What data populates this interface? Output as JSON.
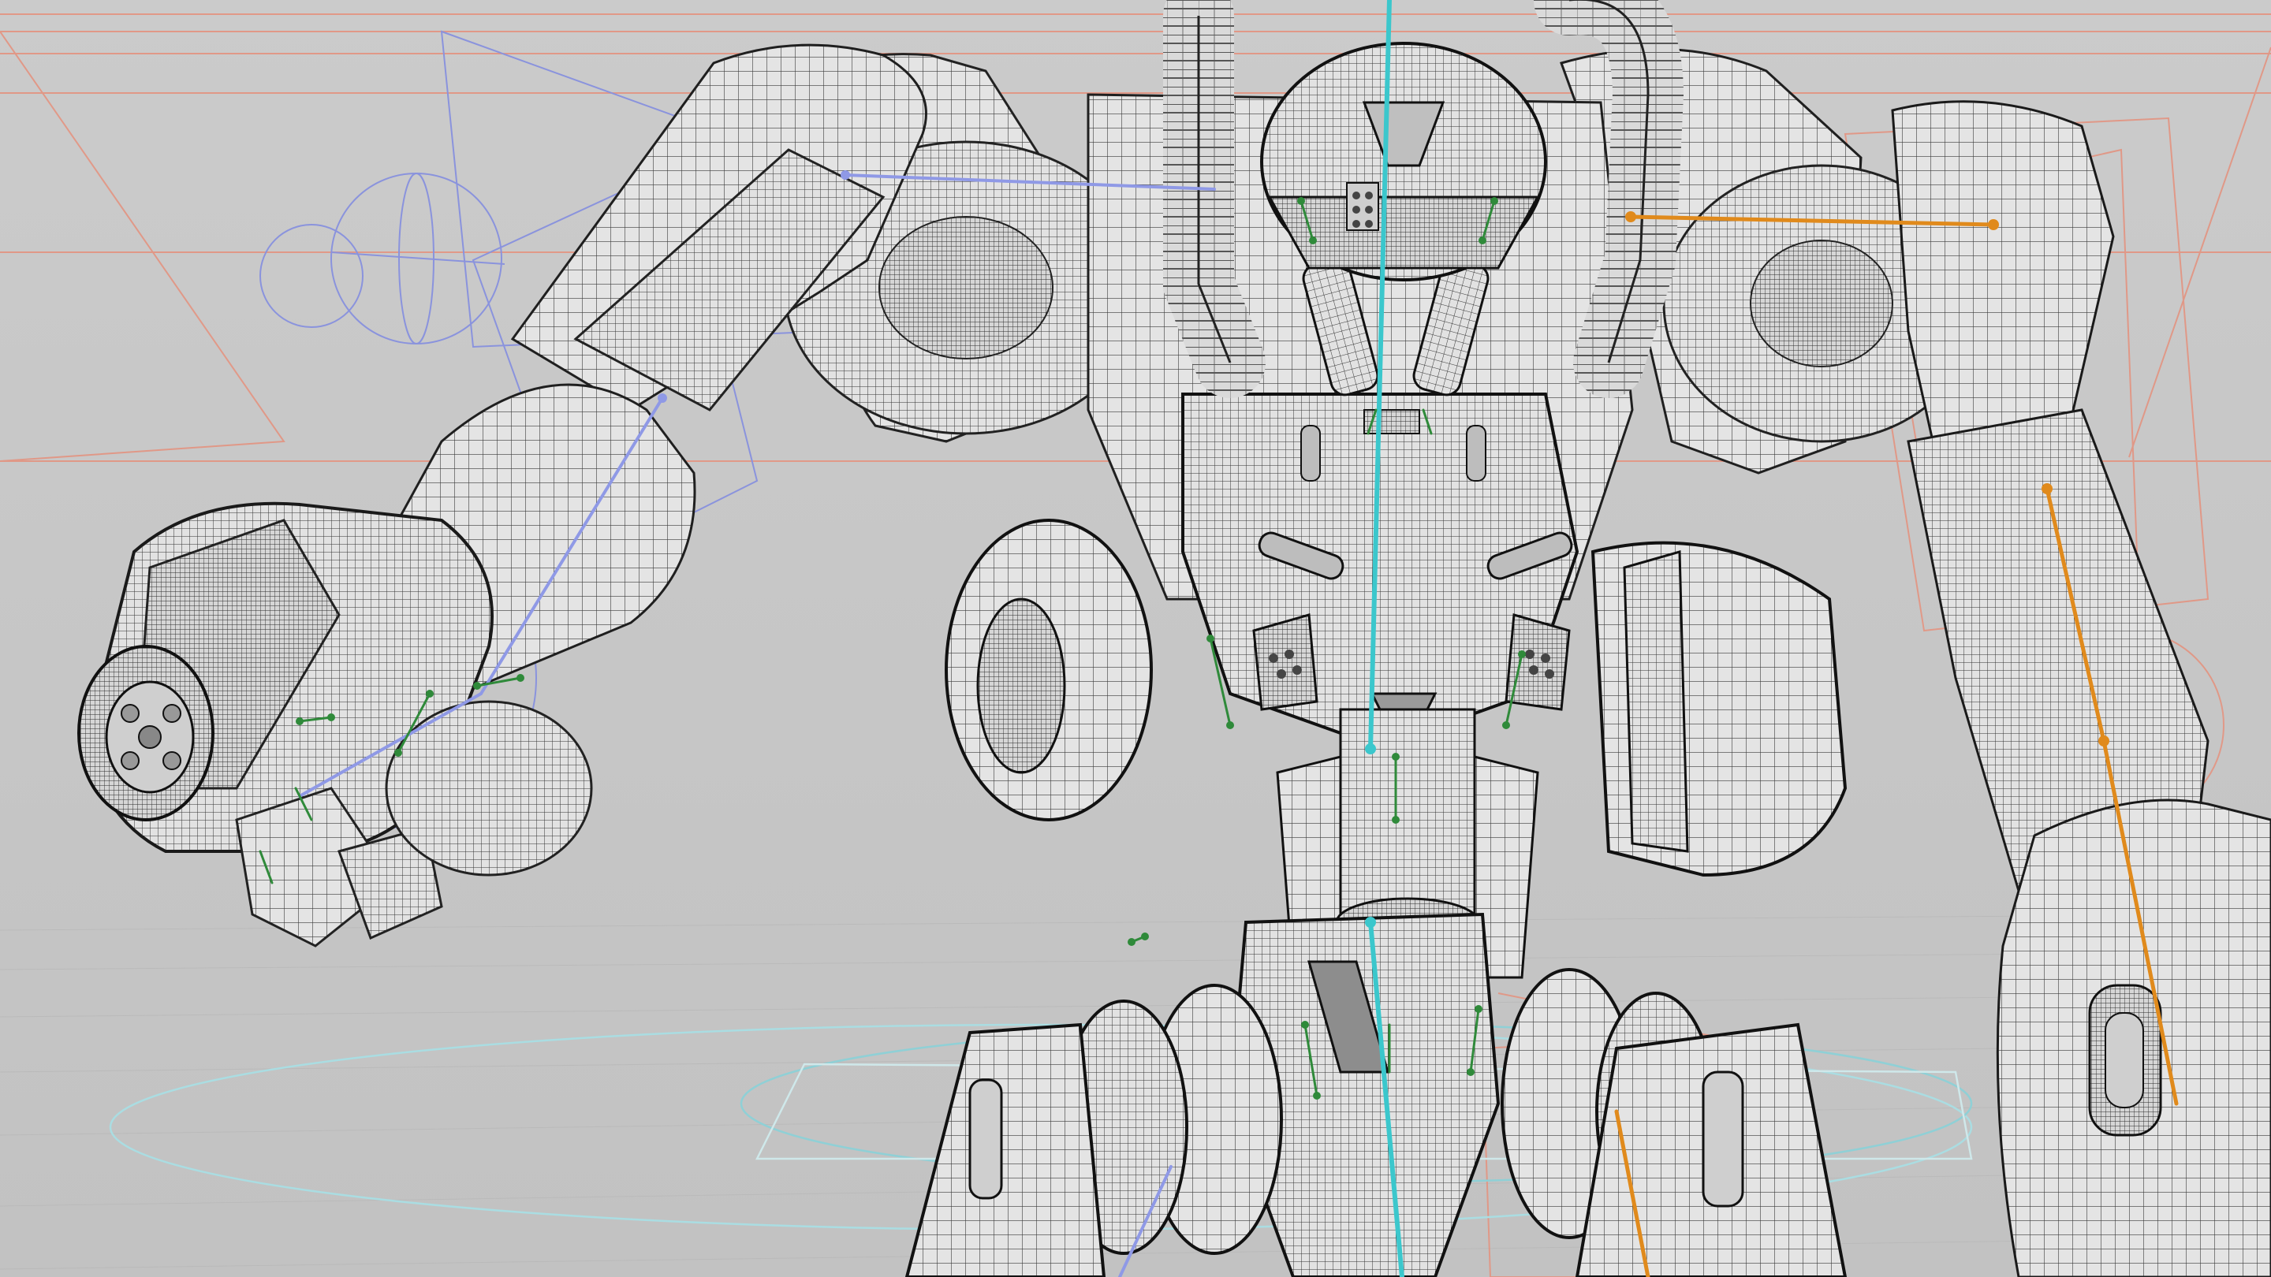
{
  "viewport": {
    "kind": "3d-wireframe-viewport",
    "subject": "mech-robot-rig",
    "display_mode": "wireframe-on-shaded"
  },
  "colors": {
    "background": "#c8c8c8",
    "mesh_fill": "#e6e6e6",
    "mesh_line": "#2b2b2b",
    "spine_bone": "#3cc8cc",
    "left_arm_bones": "#8f9ae6",
    "right_arm_bones": "#e08a1e",
    "joint_bones": "#2f8a3a",
    "guide_lines": "#e79a86",
    "ground_grid": "#b9b9b9"
  },
  "icons": {
    "rig_bone": "bone-icon",
    "rig_joint": "joint-icon",
    "ik_control": "ik-control-icon"
  }
}
